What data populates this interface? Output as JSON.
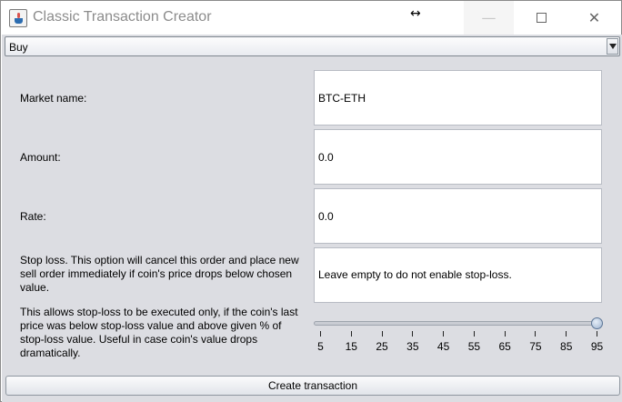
{
  "window": {
    "title": "Classic Transaction Creator",
    "icon": "java-cup-icon",
    "resize_cursor": "↔"
  },
  "type_select": {
    "value": "Buy"
  },
  "form": {
    "market_label": "Market name:",
    "market_value": "BTC-ETH",
    "amount_label": "Amount:",
    "amount_value": "0.0",
    "rate_label": "Rate:",
    "rate_value": "0.0",
    "stop_loss_label_lines": [
      "Stop loss. This option will cancel this order and place new",
      "sell order immediately if coin's price drops below chosen",
      "value."
    ],
    "stop_loss_placeholder": "Leave empty to do not enable stop-loss.",
    "slider_label_lines": [
      "This allows stop-loss to be executed only, if the coin's last",
      "price was below stop-loss value and above given % of",
      "stop-loss value. Useful in case coin's value drops",
      "dramatically."
    ]
  },
  "slider": {
    "value": 95,
    "min": 5,
    "max": 95,
    "tick_labels": [
      "5",
      "15",
      "25",
      "35",
      "45",
      "55",
      "65",
      "75",
      "85",
      "95"
    ]
  },
  "actions": {
    "create_label": "Create transaction"
  },
  "colors": {
    "panel_bg": "#dcdde2",
    "field_bg": "#ffffff",
    "title_text": "#8c8c8c"
  }
}
